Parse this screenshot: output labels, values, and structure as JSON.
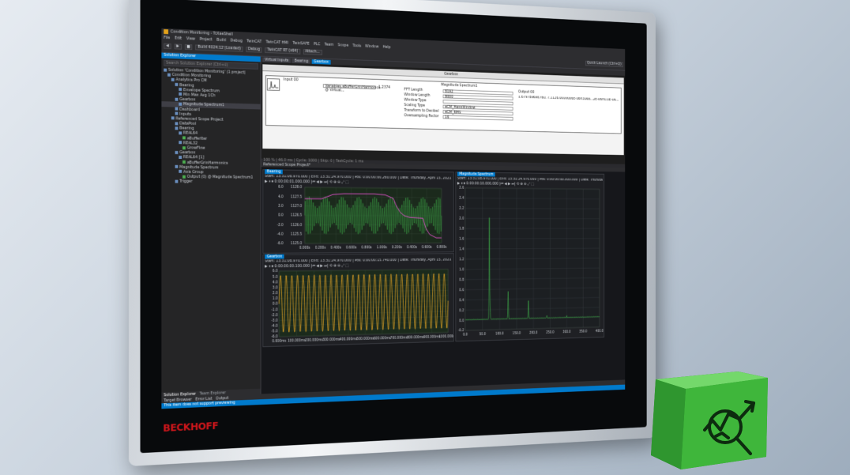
{
  "window": {
    "title": "Condition Monitoring - TcXaeShell"
  },
  "menu": [
    "File",
    "Edit",
    "View",
    "Project",
    "Build",
    "Debug",
    "TwinCAT",
    "TwinCAT HMI",
    "TwinSAFE",
    "PLC",
    "Team",
    "Scope",
    "Tools",
    "Window",
    "Help"
  ],
  "toolbar": {
    "build_target": "Build 4024.12 (Loaded)",
    "debug_label": "Debug",
    "runtime_label": "TwinCAT RT (x64)",
    "attach_label": "Attach...",
    "search_placeholder": "Quick Launch (Ctrl+Q)"
  },
  "solution_explorer": {
    "title": "Solution Explorer",
    "search_placeholder": "Search Solution Explorer (Ctrl+ü)",
    "items": [
      {
        "label": "Solution 'Condition Monitoring' (1 project)",
        "indent": 0
      },
      {
        "label": "Condition Monitoring",
        "indent": 1
      },
      {
        "label": "Analytics Pro CM",
        "indent": 2
      },
      {
        "label": "Bearing",
        "indent": 3
      },
      {
        "label": "Envelope Spectrum",
        "indent": 4
      },
      {
        "label": "Min Max Avg 1Ch",
        "indent": 4
      },
      {
        "label": "Gearbox",
        "indent": 3
      },
      {
        "label": "Magnitude Spectrum1",
        "indent": 4,
        "selected": true
      },
      {
        "label": "Dashboard",
        "indent": 3
      },
      {
        "label": "Inputs",
        "indent": 3
      },
      {
        "label": "Referenced Scope Project",
        "indent": 2
      },
      {
        "label": "DataPool",
        "indent": 3
      },
      {
        "label": "Bearing",
        "indent": 3
      },
      {
        "label": "REAL64",
        "indent": 4
      },
      {
        "label": "aBufferIter",
        "indent": 5
      },
      {
        "label": "REAL32",
        "indent": 4
      },
      {
        "label": "GrowFlow",
        "indent": 5
      },
      {
        "label": "Gearbox",
        "indent": 3
      },
      {
        "label": "REAL64 [1]",
        "indent": 4
      },
      {
        "label": "aBufferGrinHarmonics",
        "indent": 5
      },
      {
        "label": "Magnitude Spectrum",
        "indent": 3
      },
      {
        "label": "Axis Group",
        "indent": 4
      },
      {
        "label": "Output (0) @ Magnitude Spectrum1",
        "indent": 5
      },
      {
        "label": "Trigger",
        "indent": 3
      }
    ],
    "bottom_tabs": [
      "Solution Explorer",
      "Team Explorer"
    ]
  },
  "editor": {
    "tabs": [
      "Virtual Inputs",
      "Bearing",
      "Gearbox"
    ],
    "flow_label": "Gearbox",
    "block": {
      "title": "Magnitude Spectrum1",
      "input_label": "Input 00",
      "input_var": "Variables.aBufferGrinHarmonics @ Virtual...",
      "input_value": "1.2374",
      "fields": [
        {
          "label": "FFT Length",
          "value": "8192"
        },
        {
          "label": "Window Length",
          "value": "8000"
        },
        {
          "label": "Window Type",
          "value": ""
        },
        {
          "label": "Scaling Type",
          "value": "eCM_HannWindow"
        },
        {
          "label": "Transform to Decibel",
          "value": "eCM_RMS"
        },
        {
          "label": "Oversampling Factor",
          "value": "16"
        }
      ],
      "output_label": "Output 00",
      "output_value": "1.67978969E760, 7.1126.0000006E-06ri3068...2E-06ri0.0E-06..."
    },
    "status_text": "100 %  |  46.0 ms  |  Cycle: 1000  |  Skip: 0  |  TaskCycle: 1 ms"
  },
  "scope": {
    "project_label": "Referenced Scope Project*",
    "panels": [
      {
        "id": "bearing",
        "title": "Bearing",
        "info": "Start: 13:31:08.970.000  |  End: 13:31:24.970.000  |  Pos: 0:00:00:00.260.000  |  Date: Thursday, April 15, 2021",
        "tools": "▶ ⏸ ⏹  0:00:00:01.000.000  |⏮ ◀ ▶ ⏭|  ⟲ ⊕ ⊖ ⤢ ⬚"
      },
      {
        "id": "gearbox",
        "title": "Gearbox",
        "info": "Start: 13:31:08.970.000  |  End: 13:31:24.970.000  |  Pos: 0:00:00:15.740.000  |  Date: Thursday, April 15, 2021",
        "tools": "▶ ⏸ ⏹  0:00:00:00.100.000  |⏮ ◀ ▶ ⏭|  ⟲ ⊕ ⊖ ⤢ ⬚"
      },
      {
        "id": "spectrum",
        "title": "Magnitude Spectrum",
        "info": "Start: 13:31:08.970.000  |  End: 13:31:24.970.000  |  Pos: 0:00:00:00.000.000  |  Date: Thursday, April 15, 2021",
        "tools": "▶ ⏸ ⏹  0:00:00:10.000.000  |⏮ ◀ ▶ ⏭|  ⟲ ⊕ ⊖ ⤢ ⬚"
      }
    ]
  },
  "output_tabs": [
    "Target Browser",
    "Error List",
    "Output"
  ],
  "status_bar": {
    "text": "This item does not support previewing"
  },
  "brand": {
    "name": "BECKHOFF",
    "color": "#d0161b"
  },
  "colors": {
    "accent": "#007acc",
    "bearing_raw": "#3fae49",
    "bearing_env": "#d64fc2",
    "gearbox": "#e5a425",
    "spectrum": "#3fae49",
    "cube": "#3fb63b"
  },
  "chart_data": [
    {
      "id": "bearing",
      "type": "line",
      "x_ticks": [
        "0.000s",
        "0.200s",
        "0.400s",
        "0.600s",
        "0.800s",
        "1.000s",
        "0.200s",
        "0.400s",
        "0.600s",
        "0.800s"
      ],
      "y_ticks_right": [
        "1128.0",
        "1127.5",
        "1127.0",
        "1126.5",
        "1126.0",
        "1125.5",
        "1125.0"
      ],
      "y_ticks_left": [
        "6.0",
        "4.0",
        "2.0",
        "0.0",
        "-2.0",
        "-4.0",
        "-6.0"
      ],
      "ylim_left": [
        -6,
        6
      ],
      "ylim_right": [
        1125,
        1128.2
      ],
      "series": [
        {
          "kind": "oscillation",
          "amplitude": 4.2,
          "cycles": 70
        },
        {
          "kind": "envelope",
          "points": [
            [
              0,
              1127.55
            ],
            [
              0.12,
              1127.55
            ],
            [
              0.2,
              1127.8
            ],
            [
              0.28,
              1127.85
            ],
            [
              0.45,
              1127.85
            ],
            [
              0.5,
              1127.85
            ],
            [
              0.58,
              1127.8
            ],
            [
              0.64,
              1127.6
            ],
            [
              0.66,
              1127.2
            ],
            [
              0.69,
              1126.8
            ],
            [
              0.72,
              1126.6
            ],
            [
              0.76,
              1126.5
            ],
            [
              0.86,
              1126.45
            ],
            [
              0.88,
              1125.9
            ],
            [
              0.91,
              1125.5
            ],
            [
              0.96,
              1125.3
            ],
            [
              1.0,
              1125.3
            ]
          ]
        }
      ]
    },
    {
      "id": "gearbox",
      "type": "line",
      "x_ticks": [
        "0.000ms",
        "100.000ms",
        "200.000ms",
        "300.000ms",
        "400.000ms",
        "500.000ms",
        "600.000ms",
        "700.000ms",
        "800.000ms",
        "900.000ms",
        "1000.000ms"
      ],
      "y_ticks": [
        "6.0",
        "5.0",
        "4.0",
        "3.0",
        "2.0",
        "1.0",
        "0.0",
        "-1.0",
        "-2.0",
        "-3.0",
        "-4.0",
        "-5.0",
        "-6.0"
      ],
      "ylim": [
        -6,
        6
      ],
      "series": [
        {
          "kind": "sine",
          "amplitude": 5.2,
          "cycles": 31
        }
      ]
    },
    {
      "id": "spectrum",
      "type": "line",
      "x_ticks": [
        "0.0",
        "50.0",
        "100.0",
        "150.0",
        "200.0",
        "250.0",
        "300.0",
        "350.0",
        "400.0"
      ],
      "y_ticks": [
        "2.6",
        "2.4",
        "2.2",
        "2.0",
        "1.8",
        "1.6",
        "1.4",
        "1.2",
        "1.0",
        "0.8",
        "0.6",
        "0.4",
        "0.2",
        "0.0",
        "-0.2"
      ],
      "xlim": [
        0,
        400
      ],
      "ylim": [
        -0.2,
        2.6
      ],
      "peaks": [
        [
          70,
          2.0
        ],
        [
          72,
          0.3
        ],
        [
          125,
          0.55
        ],
        [
          185,
          0.35
        ],
        [
          240,
          0.05
        ],
        [
          300,
          0.03
        ]
      ]
    }
  ]
}
